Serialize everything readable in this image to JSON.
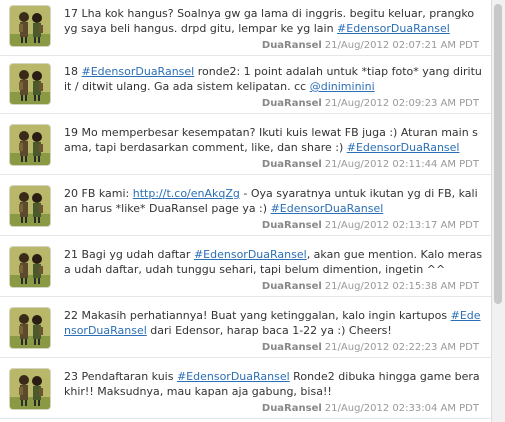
{
  "tweets": [
    {
      "parts": [
        {
          "t": "17 Lha kok hangus? Soalnya gw ga lama di inggris. begitu keluar, prangko yg saya beli hangus. drpd gitu, lempar ke yg lain "
        },
        {
          "t": "#EdensorDuaRansel",
          "link": true
        }
      ],
      "user": "DuaRansel",
      "time": "21/Aug/2012 02:07:21 AM PDT"
    },
    {
      "parts": [
        {
          "t": "18 "
        },
        {
          "t": "#EdensorDuaRansel",
          "link": true
        },
        {
          "t": " ronde2: 1 point adalah untuk *tiap foto* yang dirituit / ditwit ulang. Ga ada sistem kelipatan. cc "
        },
        {
          "t": "@diniminini",
          "link": true
        }
      ],
      "user": "DuaRansel",
      "time": "21/Aug/2012 02:09:23 AM PDT"
    },
    {
      "parts": [
        {
          "t": "19 Mo memperbesar kesempatan? Ikuti kuis lewat FB juga :) Aturan main sama, tapi berdasarkan comment, like, dan share :) "
        },
        {
          "t": "#EdensorDuaRansel",
          "link": true
        }
      ],
      "user": "DuaRansel",
      "time": "21/Aug/2012 02:11:44 AM PDT"
    },
    {
      "parts": [
        {
          "t": "20 FB kami: "
        },
        {
          "t": "http://t.co/enAkqZg",
          "link": true
        },
        {
          "t": " - Oya syaratnya untuk ikutan yg di FB, kalian harus *like* DuaRansel page ya :) "
        },
        {
          "t": "#EdensorDuaRansel",
          "link": true
        }
      ],
      "user": "DuaRansel",
      "time": "21/Aug/2012 02:13:17 AM PDT"
    },
    {
      "parts": [
        {
          "t": "21 Bagi yg udah daftar "
        },
        {
          "t": "#EdensorDuaRansel",
          "link": true
        },
        {
          "t": ", akan gue mention. Kalo merasa udah daftar, udah tunggu sehari, tapi belum dimention, ingetin ^^"
        }
      ],
      "user": "DuaRansel",
      "time": "21/Aug/2012 02:15:38 AM PDT"
    },
    {
      "parts": [
        {
          "t": "22 Makasih perhatiannya! Buat yang ketinggalan, kalo ingin kartupos "
        },
        {
          "t": "#EdensorDuaRansel",
          "link": true
        },
        {
          "t": " dari Edensor, harap baca 1-22 ya :) Cheers!"
        }
      ],
      "user": "DuaRansel",
      "time": "21/Aug/2012 02:22:23 AM PDT"
    },
    {
      "parts": [
        {
          "t": "23 Pendaftaran kuis "
        },
        {
          "t": "#EdensorDuaRansel",
          "link": true
        },
        {
          "t": " Ronde2 dibuka hingga game berakhir!! Maksudnya, mau kapan aja gabung, bisa!!"
        }
      ],
      "user": "DuaRansel",
      "time": "21/Aug/2012 02:33:04 AM PDT"
    }
  ]
}
